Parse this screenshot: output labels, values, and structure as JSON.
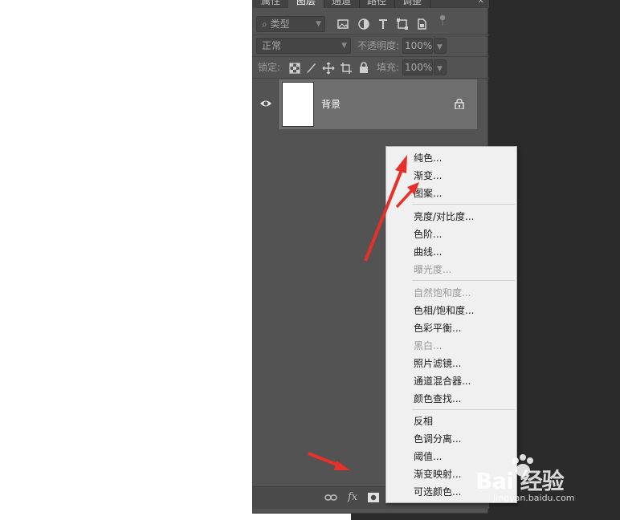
{
  "panel": {
    "tabs": [
      "属性",
      "图层",
      "通道",
      "路径",
      "调整"
    ],
    "active_tab": "图层",
    "close_icon": "close-icon",
    "filter": {
      "label": "类型",
      "icon": "search-icon"
    },
    "blend_mode": "正常",
    "opacity_label": "不透明度:",
    "opacity_value": "100%",
    "lock_label": "锁定:",
    "fill_label": "填充:",
    "fill_value": "100%"
  },
  "layer": {
    "name": "背景",
    "visible_icon": "eye-icon",
    "lock_icon": "lock-icon"
  },
  "bottom_bar": {
    "link_icon": "link-icon",
    "fx_label": "fx",
    "mask_icon": "mask-icon"
  },
  "menu": {
    "items": [
      {
        "label": "纯色...",
        "disabled": false
      },
      {
        "label": "渐变...",
        "disabled": false
      },
      {
        "label": "图案...",
        "disabled": false
      },
      {
        "label": "亮度/对比度...",
        "disabled": false
      },
      {
        "label": "色阶...",
        "disabled": false
      },
      {
        "label": "曲线...",
        "disabled": false
      },
      {
        "label": "曝光度...",
        "disabled": true
      },
      {
        "label": "自然饱和度...",
        "disabled": true
      },
      {
        "label": "色相/饱和度...",
        "disabled": false
      },
      {
        "label": "色彩平衡...",
        "disabled": false
      },
      {
        "label": "黑白...",
        "disabled": true
      },
      {
        "label": "照片滤镜...",
        "disabled": false
      },
      {
        "label": "通道混合器...",
        "disabled": false
      },
      {
        "label": "颜色查找...",
        "disabled": false
      },
      {
        "label": "反相",
        "disabled": false
      },
      {
        "label": "色调分离...",
        "disabled": false
      },
      {
        "label": "阈值...",
        "disabled": false
      },
      {
        "label": "渐变映射...",
        "disabled": false
      },
      {
        "label": "可选颜色...",
        "disabled": false
      }
    ]
  },
  "watermark": {
    "main": "Bai 经验",
    "sub": "jingyan.baidu.com"
  },
  "colors": {
    "panel_bg": "#535353",
    "menu_bg": "#f0f0f0",
    "arrow": "#e8302b"
  }
}
